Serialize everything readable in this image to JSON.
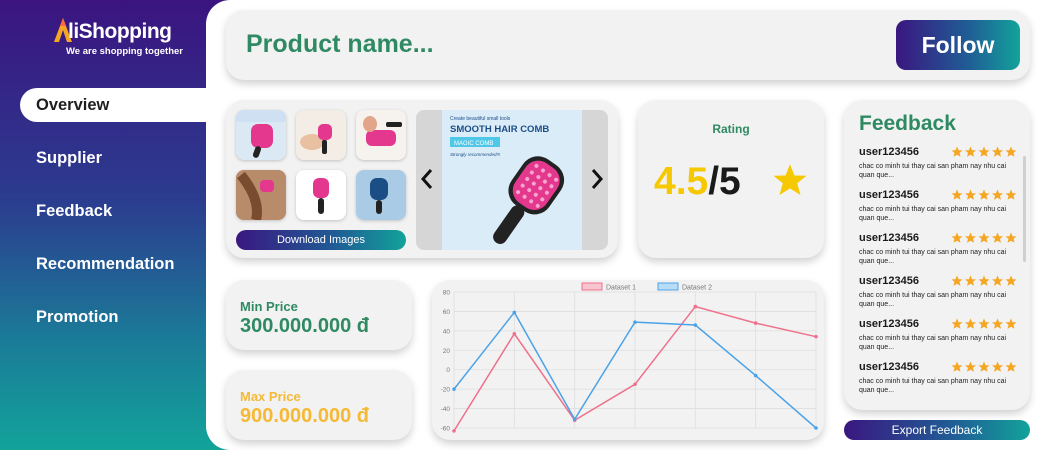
{
  "app": {
    "logo_text": "liShopping",
    "tagline": "We are shopping together"
  },
  "sidebar": {
    "items": [
      {
        "label": "Overview",
        "active": true
      },
      {
        "label": "Supplier",
        "active": false
      },
      {
        "label": "Feedback",
        "active": false
      },
      {
        "label": "Recommendation",
        "active": false
      },
      {
        "label": "Promotion",
        "active": false
      }
    ]
  },
  "header": {
    "product_name": "Product name...",
    "follow_label": "Follow"
  },
  "images": {
    "download_label": "Download Images",
    "main_caption_top": "Create beautiful small tools",
    "main_title": "SMOOTH HAIR COMB",
    "main_badge": "MAGIC COMB",
    "main_note": "Strongly recommended!!!"
  },
  "rating": {
    "label": "Rating",
    "score": "4.5",
    "max": "/5"
  },
  "feedback": {
    "title": "Feedback",
    "export_label": "Export Feedback",
    "items": [
      {
        "user": "user123456",
        "stars": 5,
        "text": "chac co minh tui thay cai san pham nay nhu cai quan que..."
      },
      {
        "user": "user123456",
        "stars": 5,
        "text": "chac co minh tui thay cai san pham nay nhu cai quan que..."
      },
      {
        "user": "user123456",
        "stars": 5,
        "text": "chac co minh tui thay cai san pham nay nhu cai quan que..."
      },
      {
        "user": "user123456",
        "stars": 5,
        "text": "chac co minh tui thay cai san pham nay nhu cai quan que..."
      },
      {
        "user": "user123456",
        "stars": 5,
        "text": "chac co minh tui thay cai san pham nay nhu cai quan que..."
      },
      {
        "user": "user123456",
        "stars": 5,
        "text": "chac co minh tui thay cai san pham nay nhu cai quan que..."
      }
    ]
  },
  "prices": {
    "min_label": "Min Price",
    "min_value": "300.000.000 đ",
    "max_label": "Max Price",
    "max_value": "900.000.000 đ"
  },
  "colors": {
    "brand_green": "#2f8a63",
    "max_price_yellow": "#f5b935",
    "rating_yellow": "#f5c800",
    "star_orange": "#f5a623",
    "series1": "#f0708a",
    "series2": "#4aa3e8"
  },
  "chart_data": {
    "type": "line",
    "x": [
      1,
      2,
      3,
      4,
      5,
      6,
      7
    ],
    "ylim": [
      -60,
      80
    ],
    "yticks": [
      80,
      60,
      40,
      20,
      0,
      -20,
      -40,
      -60
    ],
    "grid": true,
    "legend": "top",
    "series": [
      {
        "name": "Dataset 1",
        "values": [
          -63,
          37,
          -52,
          -15,
          65,
          48,
          34
        ]
      },
      {
        "name": "Dataset 2",
        "values": [
          -20,
          59,
          -51,
          49,
          46,
          -6,
          -60
        ]
      }
    ]
  }
}
